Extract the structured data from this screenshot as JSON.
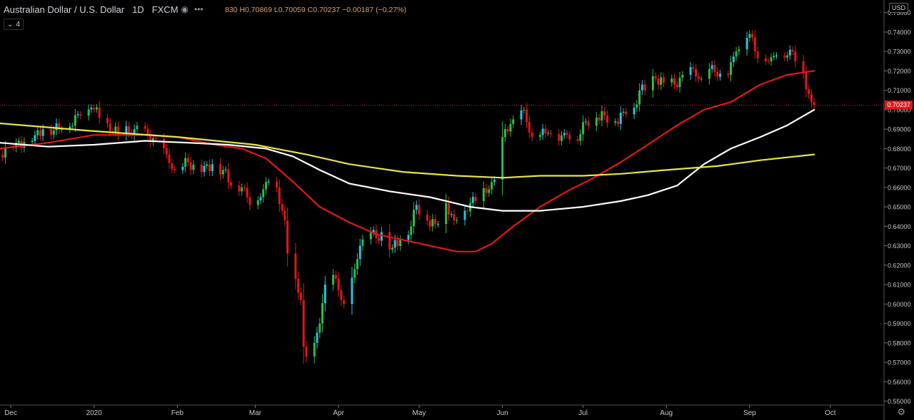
{
  "header": {
    "symbol": "Australian Dollar / U.S. Dollar",
    "interval": "1D",
    "exchange": "FXCM",
    "eye_icon": "eye-icon",
    "more_icon": "more-dots-icon",
    "ohlc": {
      "open_partial": "830",
      "high": "H0.70869",
      "low": "L0.70059",
      "close": "C0.70237",
      "change": "−0.00187 (−0.27%)"
    }
  },
  "indicator_badge": {
    "icon": "chevron-down-icon",
    "count": "4"
  },
  "currency_label": "USD",
  "last_price_label": "0.70237",
  "settings_icon": "gear-icon",
  "colors": {
    "background": "#000000",
    "bull": "#2ebd4a",
    "bull_alt": "#26c6da",
    "bear": "#e2161c",
    "ma_red": "#e2161c",
    "ma_white": "#ffffff",
    "ma_yellow": "#e8e34a",
    "axis_text": "#c8c8c8"
  },
  "chart_data": {
    "type": "candlestick",
    "ylim": [
      0.548,
      0.7565
    ],
    "y_ticks": [
      0.55,
      0.56,
      0.57,
      0.58,
      0.59,
      0.6,
      0.61,
      0.62,
      0.63,
      0.64,
      0.65,
      0.66,
      0.67,
      0.68,
      0.69,
      0.7,
      0.71,
      0.72,
      0.73,
      0.74,
      0.75
    ],
    "y_tick_labels": [
      "0.55000",
      "0.56000",
      "0.57000",
      "0.58000",
      "0.59000",
      "0.60000",
      "0.61000",
      "0.62000",
      "0.63000",
      "0.64000",
      "0.65000",
      "0.66000",
      "0.67000",
      "0.68000",
      "0.69000",
      "0.70000",
      "0.71000",
      "0.72000",
      "0.73000",
      "0.74000",
      "0.75000"
    ],
    "x_tick_labels": [
      "Dec",
      "2020",
      "Feb",
      "Mar",
      "Apr",
      "May",
      "Jun",
      "Jul",
      "Aug",
      "Sep",
      "Oct"
    ],
    "x_tick_dates": [
      "2019-12-01",
      "2020-01-01",
      "2020-02-01",
      "2020-03-01",
      "2020-04-01",
      "2020-05-01",
      "2020-06-01",
      "2020-07-01",
      "2020-08-01",
      "2020-09-01",
      "2020-10-01"
    ],
    "xlim": [
      "2019-11-27",
      "2020-10-21"
    ],
    "last_price": 0.70237,
    "close_points": [
      [
        "2019-11-27",
        0.677
      ],
      [
        "2019-12-03",
        0.683
      ],
      [
        "2019-12-09",
        0.684
      ],
      [
        "2019-12-13",
        0.69
      ],
      [
        "2019-12-20",
        0.69
      ],
      [
        "2019-12-27",
        0.697
      ],
      [
        "2019-12-31",
        0.701
      ],
      [
        "2020-01-06",
        0.693
      ],
      [
        "2020-01-10",
        0.687
      ],
      [
        "2020-01-16",
        0.69
      ],
      [
        "2020-01-21",
        0.687
      ],
      [
        "2020-01-24",
        0.685
      ],
      [
        "2020-01-28",
        0.677
      ],
      [
        "2020-01-31",
        0.669
      ],
      [
        "2020-02-05",
        0.673
      ],
      [
        "2020-02-10",
        0.668
      ],
      [
        "2020-02-14",
        0.672
      ],
      [
        "2020-02-18",
        0.669
      ],
      [
        "2020-02-21",
        0.661
      ],
      [
        "2020-02-25",
        0.66
      ],
      [
        "2020-02-28",
        0.651
      ],
      [
        "2020-03-03",
        0.655
      ],
      [
        "2020-03-06",
        0.663
      ],
      [
        "2020-03-09",
        0.66
      ],
      [
        "2020-03-12",
        0.643
      ],
      [
        "2020-03-13",
        0.626
      ],
      [
        "2020-03-16",
        0.613
      ],
      [
        "2020-03-18",
        0.602
      ],
      [
        "2020-03-19",
        0.578
      ],
      [
        "2020-03-20",
        0.573
      ],
      [
        "2020-03-23",
        0.58
      ],
      [
        "2020-03-25",
        0.59
      ],
      [
        "2020-03-27",
        0.61
      ],
      [
        "2020-03-30",
        0.615
      ],
      [
        "2020-04-01",
        0.607
      ],
      [
        "2020-04-03",
        0.6
      ],
      [
        "2020-04-07",
        0.618
      ],
      [
        "2020-04-09",
        0.63
      ],
      [
        "2020-04-13",
        0.637
      ],
      [
        "2020-04-15",
        0.634
      ],
      [
        "2020-04-17",
        0.637
      ],
      [
        "2020-04-21",
        0.629
      ],
      [
        "2020-04-24",
        0.633
      ],
      [
        "2020-04-28",
        0.64
      ],
      [
        "2020-04-30",
        0.651
      ],
      [
        "2020-05-04",
        0.643
      ],
      [
        "2020-05-07",
        0.641
      ],
      [
        "2020-05-11",
        0.652
      ],
      [
        "2020-05-14",
        0.643
      ],
      [
        "2020-05-18",
        0.648
      ],
      [
        "2020-05-20",
        0.652
      ],
      [
        "2020-05-22",
        0.653
      ],
      [
        "2020-05-27",
        0.659
      ],
      [
        "2020-05-29",
        0.664
      ],
      [
        "2020-06-02",
        0.69
      ],
      [
        "2020-06-05",
        0.695
      ],
      [
        "2020-06-09",
        0.7
      ],
      [
        "2020-06-12",
        0.686
      ],
      [
        "2020-06-15",
        0.687
      ],
      [
        "2020-06-18",
        0.688
      ],
      [
        "2020-06-22",
        0.684
      ],
      [
        "2020-06-25",
        0.687
      ],
      [
        "2020-06-29",
        0.684
      ],
      [
        "2020-07-02",
        0.694
      ],
      [
        "2020-07-06",
        0.696
      ],
      [
        "2020-07-09",
        0.697
      ],
      [
        "2020-07-13",
        0.694
      ],
      [
        "2020-07-16",
        0.699
      ],
      [
        "2020-07-20",
        0.701
      ],
      [
        "2020-07-22",
        0.71
      ],
      [
        "2020-07-24",
        0.71
      ],
      [
        "2020-07-28",
        0.716
      ],
      [
        "2020-07-31",
        0.714
      ],
      [
        "2020-08-04",
        0.713
      ],
      [
        "2020-08-07",
        0.718
      ],
      [
        "2020-08-11",
        0.721
      ],
      [
        "2020-08-14",
        0.716
      ],
      [
        "2020-08-18",
        0.723
      ],
      [
        "2020-08-20",
        0.717
      ],
      [
        "2020-08-24",
        0.718
      ],
      [
        "2020-08-27",
        0.73
      ],
      [
        "2020-08-31",
        0.737
      ],
      [
        "2020-09-01",
        0.739
      ],
      [
        "2020-09-03",
        0.73
      ],
      [
        "2020-09-07",
        0.725
      ],
      [
        "2020-09-09",
        0.727
      ],
      [
        "2020-09-11",
        0.728
      ],
      [
        "2020-09-15",
        0.728
      ],
      [
        "2020-09-17",
        0.73
      ],
      [
        "2020-09-21",
        0.719
      ],
      [
        "2020-09-23",
        0.708
      ],
      [
        "2020-09-24",
        0.704
      ],
      [
        "2020-09-25",
        0.7024
      ]
    ],
    "moving_averages": [
      {
        "color": "#e2161c",
        "points": [
          [
            "2019-11-27",
            0.68
          ],
          [
            "2019-12-15",
            0.683
          ],
          [
            "2020-01-01",
            0.687
          ],
          [
            "2020-01-20",
            0.687
          ],
          [
            "2020-02-01",
            0.686
          ],
          [
            "2020-02-15",
            0.682
          ],
          [
            "2020-02-25",
            0.68
          ],
          [
            "2020-03-05",
            0.675
          ],
          [
            "2020-03-15",
            0.663
          ],
          [
            "2020-03-25",
            0.65
          ],
          [
            "2020-04-05",
            0.642
          ],
          [
            "2020-04-15",
            0.636
          ],
          [
            "2020-04-25",
            0.633
          ],
          [
            "2020-05-05",
            0.63
          ],
          [
            "2020-05-15",
            0.627
          ],
          [
            "2020-05-22",
            0.627
          ],
          [
            "2020-05-28",
            0.631
          ],
          [
            "2020-06-05",
            0.64
          ],
          [
            "2020-06-15",
            0.65
          ],
          [
            "2020-06-25",
            0.658
          ],
          [
            "2020-07-05",
            0.665
          ],
          [
            "2020-07-15",
            0.673
          ],
          [
            "2020-07-25",
            0.682
          ],
          [
            "2020-08-05",
            0.692
          ],
          [
            "2020-08-15",
            0.7
          ],
          [
            "2020-08-25",
            0.704
          ],
          [
            "2020-09-05",
            0.713
          ],
          [
            "2020-09-15",
            0.718
          ],
          [
            "2020-09-25",
            0.72
          ]
        ]
      },
      {
        "color": "#ffffff",
        "points": [
          [
            "2019-11-27",
            0.683
          ],
          [
            "2019-12-15",
            0.681
          ],
          [
            "2020-01-01",
            0.682
          ],
          [
            "2020-01-20",
            0.684
          ],
          [
            "2020-02-05",
            0.683
          ],
          [
            "2020-02-20",
            0.682
          ],
          [
            "2020-03-05",
            0.68
          ],
          [
            "2020-03-15",
            0.676
          ],
          [
            "2020-03-25",
            0.669
          ],
          [
            "2020-04-05",
            0.662
          ],
          [
            "2020-04-20",
            0.658
          ],
          [
            "2020-05-05",
            0.655
          ],
          [
            "2020-05-20",
            0.65
          ],
          [
            "2020-06-01",
            0.648
          ],
          [
            "2020-06-15",
            0.648
          ],
          [
            "2020-07-01",
            0.65
          ],
          [
            "2020-07-15",
            0.653
          ],
          [
            "2020-07-25",
            0.656
          ],
          [
            "2020-08-05",
            0.661
          ],
          [
            "2020-08-15",
            0.672
          ],
          [
            "2020-08-25",
            0.68
          ],
          [
            "2020-09-05",
            0.686
          ],
          [
            "2020-09-15",
            0.692
          ],
          [
            "2020-09-25",
            0.7
          ]
        ]
      },
      {
        "color": "#e8e34a",
        "points": [
          [
            "2019-11-27",
            0.693
          ],
          [
            "2020-01-01",
            0.689
          ],
          [
            "2020-02-01",
            0.686
          ],
          [
            "2020-03-01",
            0.682
          ],
          [
            "2020-03-20",
            0.677
          ],
          [
            "2020-04-05",
            0.672
          ],
          [
            "2020-04-25",
            0.668
          ],
          [
            "2020-05-15",
            0.666
          ],
          [
            "2020-06-01",
            0.665
          ],
          [
            "2020-06-15",
            0.666
          ],
          [
            "2020-07-01",
            0.666
          ],
          [
            "2020-07-15",
            0.667
          ],
          [
            "2020-08-01",
            0.669
          ],
          [
            "2020-08-20",
            0.671
          ],
          [
            "2020-09-05",
            0.674
          ],
          [
            "2020-09-25",
            0.677
          ]
        ]
      }
    ]
  }
}
